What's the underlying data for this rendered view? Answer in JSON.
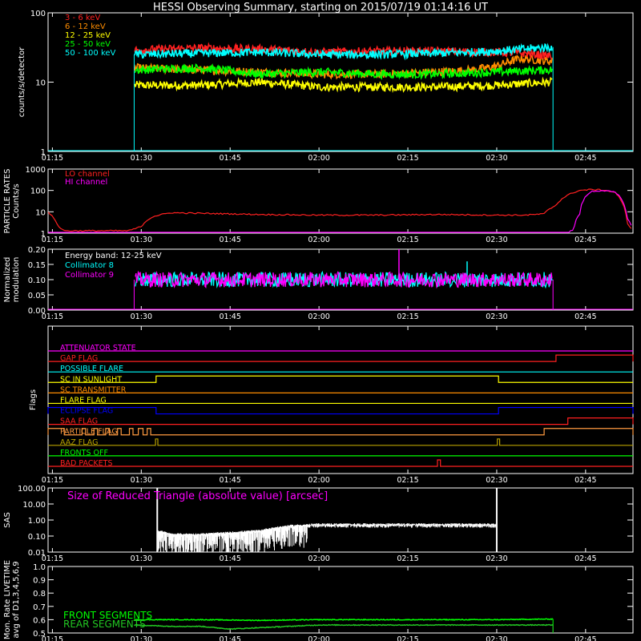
{
  "title": "HESSI Observing Summary, starting on 2015/07/19 01:14:16 UT",
  "time_ticks": [
    "01:15",
    "01:30",
    "01:45",
    "02:00",
    "02:15",
    "02:30",
    "02:45"
  ],
  "colors": {
    "bg": "#000000",
    "axis": "#ffffff",
    "red": "#ff2020",
    "orange": "#ff8c00",
    "yellow": "#ffff00",
    "green": "#00ff00",
    "cyan": "#00ffff",
    "magenta": "#ff00ff",
    "blue": "#0000ff",
    "darkred": "#e02020",
    "olive": "#b8a000",
    "tan": "#ff9a40",
    "darkgreen": "#22c822"
  },
  "chart_data": [
    {
      "id": "counts",
      "type": "line",
      "ylabel": "counts/s/detector",
      "yscale": "log",
      "ylim": [
        1,
        100
      ],
      "yticks": [
        "1",
        "10",
        "100"
      ],
      "xlim_minutes": [
        74.27,
        173.0
      ],
      "data_start": 88.8,
      "data_end": 159.5,
      "series": [
        {
          "name": "3 - 6 keV",
          "label": "3 - 6 keV",
          "color": "red",
          "x": [
            89,
            100,
            110,
            120,
            130,
            140,
            150,
            155,
            159
          ],
          "y": [
            29,
            31,
            30,
            27,
            28,
            28,
            27,
            26,
            24
          ]
        },
        {
          "name": "6 - 12 keV",
          "label": "6 - 12 keV",
          "color": "orange",
          "x": [
            89,
            100,
            110,
            120,
            130,
            140,
            146,
            150,
            154,
            159
          ],
          "y": [
            16,
            15,
            14,
            13,
            13,
            14,
            15,
            17,
            22,
            20
          ]
        },
        {
          "name": "12 - 25 keV",
          "label": "12 - 25 keV",
          "color": "yellow",
          "x": [
            89,
            100,
            110,
            120,
            130,
            140,
            150,
            159
          ],
          "y": [
            9,
            9,
            10,
            8.5,
            8.5,
            8.5,
            9,
            10
          ]
        },
        {
          "name": "25 - 50 keV",
          "label": "25 - 50 keV",
          "color": "green",
          "x": [
            89,
            100,
            110,
            120,
            130,
            140,
            150,
            159
          ],
          "y": [
            15,
            16,
            13,
            14,
            13,
            13,
            14,
            15
          ]
        },
        {
          "name": "50 - 100 keV",
          "label": "50 - 100 keV",
          "color": "cyan",
          "x": [
            89,
            100,
            110,
            120,
            130,
            140,
            150,
            159
          ],
          "y": [
            25,
            26,
            27,
            25,
            25,
            26,
            28,
            32
          ]
        }
      ]
    },
    {
      "id": "particle",
      "type": "line",
      "ylabel": "PARTICLE RATES",
      "ylabel2": "Counts/s",
      "yscale": "log",
      "ylim": [
        1,
        1000
      ],
      "yticks": [
        "1",
        "10",
        "100",
        "1000"
      ],
      "xlim_minutes": [
        74.27,
        173.0
      ],
      "series": [
        {
          "name": "LO channel",
          "label": "LO channel",
          "color": "red",
          "x": [
            74.3,
            75,
            76,
            77,
            78,
            80,
            85,
            88,
            90,
            92,
            95,
            100,
            110,
            120,
            130,
            140,
            150,
            155,
            158,
            160,
            162,
            164,
            166,
            168,
            170,
            171,
            172,
            173
          ],
          "y": [
            9,
            6,
            2,
            1.3,
            1.3,
            1.3,
            1.3,
            1.3,
            2,
            6,
            9,
            8.5,
            7.5,
            7,
            7,
            7.5,
            7,
            7,
            8,
            20,
            60,
            100,
            110,
            105,
            80,
            30,
            3,
            1
          ]
        },
        {
          "name": "HI channel",
          "label": "HI channel",
          "color": "magenta",
          "x": [
            74.3,
            162,
            163,
            164,
            165,
            166,
            168,
            170,
            171,
            172,
            173
          ],
          "y": [
            1,
            1,
            1.5,
            8,
            50,
            90,
            100,
            80,
            40,
            5,
            1
          ]
        }
      ]
    },
    {
      "id": "modulation",
      "type": "line",
      "ylabel": "Normalized",
      "ylabel2": "modulation",
      "ylim": [
        0,
        0.2
      ],
      "yticks": [
        "0.00",
        "0.05",
        "0.10",
        "0.15",
        "0.20"
      ],
      "annotation": "Energy band: 12-25 keV",
      "series": [
        {
          "name": "Collimator 8",
          "label": "Collimator 8",
          "color": "cyan",
          "mean": 0.1,
          "spike_x": 145.0,
          "spike_y": 0.16
        },
        {
          "name": "Collimator 9",
          "label": "Collimator 9",
          "color": "magenta",
          "mean": 0.1,
          "spike_x": 133.5,
          "spike_y": 0.2
        }
      ]
    },
    {
      "id": "flags",
      "type": "line",
      "ylabel": "Flags",
      "series": [
        {
          "name": "ATTENUATOR STATE",
          "label": "ATTENUATOR STATE",
          "color": "magenta",
          "steps": []
        },
        {
          "name": "GAP FLAG",
          "label": "GAP FLAG",
          "color": "red",
          "steps": [
            [
              160,
              173
            ]
          ]
        },
        {
          "name": "POSSIBLE FLARE",
          "label": "POSSIBLE FLARE",
          "color": "cyan",
          "steps": []
        },
        {
          "name": "SC IN SUNLIGHT",
          "label": "SC IN SUNLIGHT",
          "color": "yellow",
          "steps": [
            [
              92.5,
              150.3
            ]
          ]
        },
        {
          "name": "SC TRANSMITTER",
          "label": "SC TRANSMITTER",
          "color": "orange",
          "steps": []
        },
        {
          "name": "FLARE FLAG",
          "label": "FLARE FLAG",
          "color": "yellow",
          "steps": []
        },
        {
          "name": "ECLIPSE FLAG",
          "label": "ECLIPSE FLAG",
          "color": "blue",
          "steps": [
            [
              74.27,
              92.5
            ],
            [
              150.3,
              173
            ]
          ]
        },
        {
          "name": "SAA FLAG",
          "label": "SAA FLAG",
          "color": "red",
          "steps": [
            [
              162,
              173
            ]
          ]
        },
        {
          "name": "PARTICLE FLAG",
          "label": "PARTICLE FLAG",
          "color": "tan",
          "steps": [
            [
              74.27,
              77
            ],
            [
              80,
              80.6
            ],
            [
              82,
              82.6
            ],
            [
              84,
              84.6
            ],
            [
              86,
              86.6
            ],
            [
              88,
              88.6
            ],
            [
              89.5,
              90.3
            ],
            [
              91,
              91.6
            ],
            [
              158,
              173
            ]
          ]
        },
        {
          "name": "AAZ FLAG",
          "label": "AAZ FLAG",
          "color": "olive",
          "steps": [
            [
              92.4,
              92.8
            ],
            [
              150.1,
              150.5
            ]
          ]
        },
        {
          "name": "FRONTS OFF",
          "label": "FRONTS OFF",
          "color": "green",
          "steps": []
        },
        {
          "name": "BAD PACKETS",
          "label": "BAD PACKETS",
          "color": "red",
          "steps": [
            [
              140,
              140.5
            ]
          ]
        }
      ]
    },
    {
      "id": "sas",
      "type": "line",
      "ylabel": "SAS",
      "yscale": "log",
      "ylim": [
        0.01,
        100
      ],
      "yticks": [
        "0.01",
        "0.10",
        "1.00",
        "10.00",
        "100.00"
      ],
      "annotation": "Size of Reduced Triangle (absolute value) [arcsec]",
      "series": [
        {
          "name": "Size of Reduced Triangle",
          "color": "axis",
          "x": [
            92.7,
            95,
            100,
            105,
            110,
            115,
            120,
            125,
            130,
            140,
            150
          ],
          "y": [
            0.2,
            0.12,
            0.12,
            0.15,
            0.2,
            0.4,
            0.5,
            0.5,
            0.5,
            0.5,
            0.5
          ]
        }
      ]
    },
    {
      "id": "livetime",
      "type": "line",
      "ylabel": "Mon. Rate LIVETIME",
      "ylabel2": "avg of D1,3,4,5,6,9",
      "ylim": [
        0.5,
        1.0
      ],
      "yticks": [
        "0.5",
        "0.6",
        "0.7",
        "0.8",
        "0.9",
        "1.0"
      ],
      "series": [
        {
          "name": "FRONT SEGMENTS",
          "label": "FRONT SEGMENTS",
          "color": "green",
          "x": [
            88.8,
            100,
            110,
            120,
            130,
            140,
            150,
            159.5
          ],
          "y": [
            0.6,
            0.6,
            0.595,
            0.6,
            0.6,
            0.6,
            0.6,
            0.605
          ]
        },
        {
          "name": "REAR SEGMENTS",
          "label": "REAR SEGMENTS",
          "color": "darkgreen",
          "x": [
            88.8,
            95,
            100,
            105,
            110,
            115,
            120,
            130,
            140,
            150,
            159.5
          ],
          "y": [
            0.56,
            0.55,
            0.55,
            0.53,
            0.54,
            0.55,
            0.56,
            0.56,
            0.56,
            0.56,
            0.56
          ]
        }
      ]
    }
  ]
}
